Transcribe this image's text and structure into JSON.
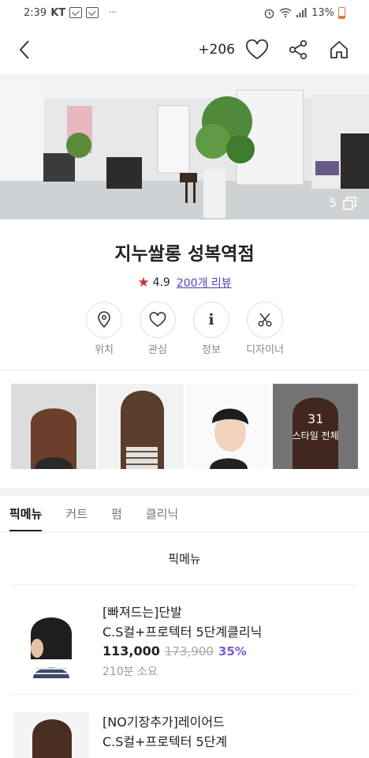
{
  "status": {
    "time": "2:39",
    "carrier": "KT",
    "dots": "···",
    "battery": "13%"
  },
  "header": {
    "likes_count": "+206"
  },
  "hero": {
    "photo_count": "5"
  },
  "shop": {
    "name": "지누쌀롱 성복역점",
    "rating": "4.9",
    "reviews_label": "200개 리뷰"
  },
  "actions": [
    {
      "label": "위치",
      "icon": "location-pin-icon"
    },
    {
      "label": "관심",
      "icon": "heart-icon"
    },
    {
      "label": "정보",
      "icon": "info-icon"
    },
    {
      "label": "디자이너",
      "icon": "scissors-icon"
    }
  ],
  "styles": {
    "total_count": "31",
    "total_label": "스타일 전체"
  },
  "tabs": [
    "픽메뉴",
    "커트",
    "펌",
    "클리닉"
  ],
  "section": {
    "title": "픽메뉴"
  },
  "menu_items": [
    {
      "line1": "[빠져드는]단발",
      "line2": "C.S컬+프로텍터 5단계클리닉",
      "price": "113,000",
      "original_price": "173,900",
      "discount": "35%",
      "duration": "210분 소요"
    },
    {
      "line1": "[NO기장추가]레이어드",
      "line2": "C.S컬+프로텍터 5단계"
    }
  ],
  "colors": {
    "accent": "#7b5bd4",
    "star": "#d32f2f",
    "review_link": "#5a3fbf"
  }
}
